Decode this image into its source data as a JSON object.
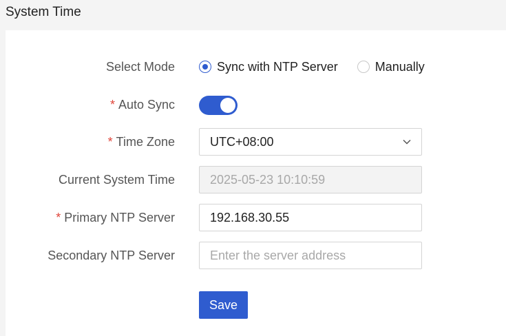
{
  "header": {
    "title": "System Time"
  },
  "form": {
    "select_mode": {
      "label": "Select Mode",
      "options": [
        {
          "label": "Sync with NTP Server",
          "selected": true
        },
        {
          "label": "Manually",
          "selected": false
        }
      ]
    },
    "auto_sync": {
      "required_mark": "*",
      "label": "Auto Sync",
      "enabled": true
    },
    "time_zone": {
      "required_mark": "*",
      "label": "Time Zone",
      "value": "UTC+08:00"
    },
    "current_system_time": {
      "label": "Current System Time",
      "value": "2025-05-23 10:10:59"
    },
    "primary_ntp": {
      "required_mark": "*",
      "label": "Primary NTP Server",
      "value": "192.168.30.55"
    },
    "secondary_ntp": {
      "label": "Secondary NTP Server",
      "value": "",
      "placeholder": "Enter the server address"
    },
    "save_label": "Save"
  },
  "colors": {
    "accent": "#2f5ccf",
    "required": "#e0453a"
  }
}
